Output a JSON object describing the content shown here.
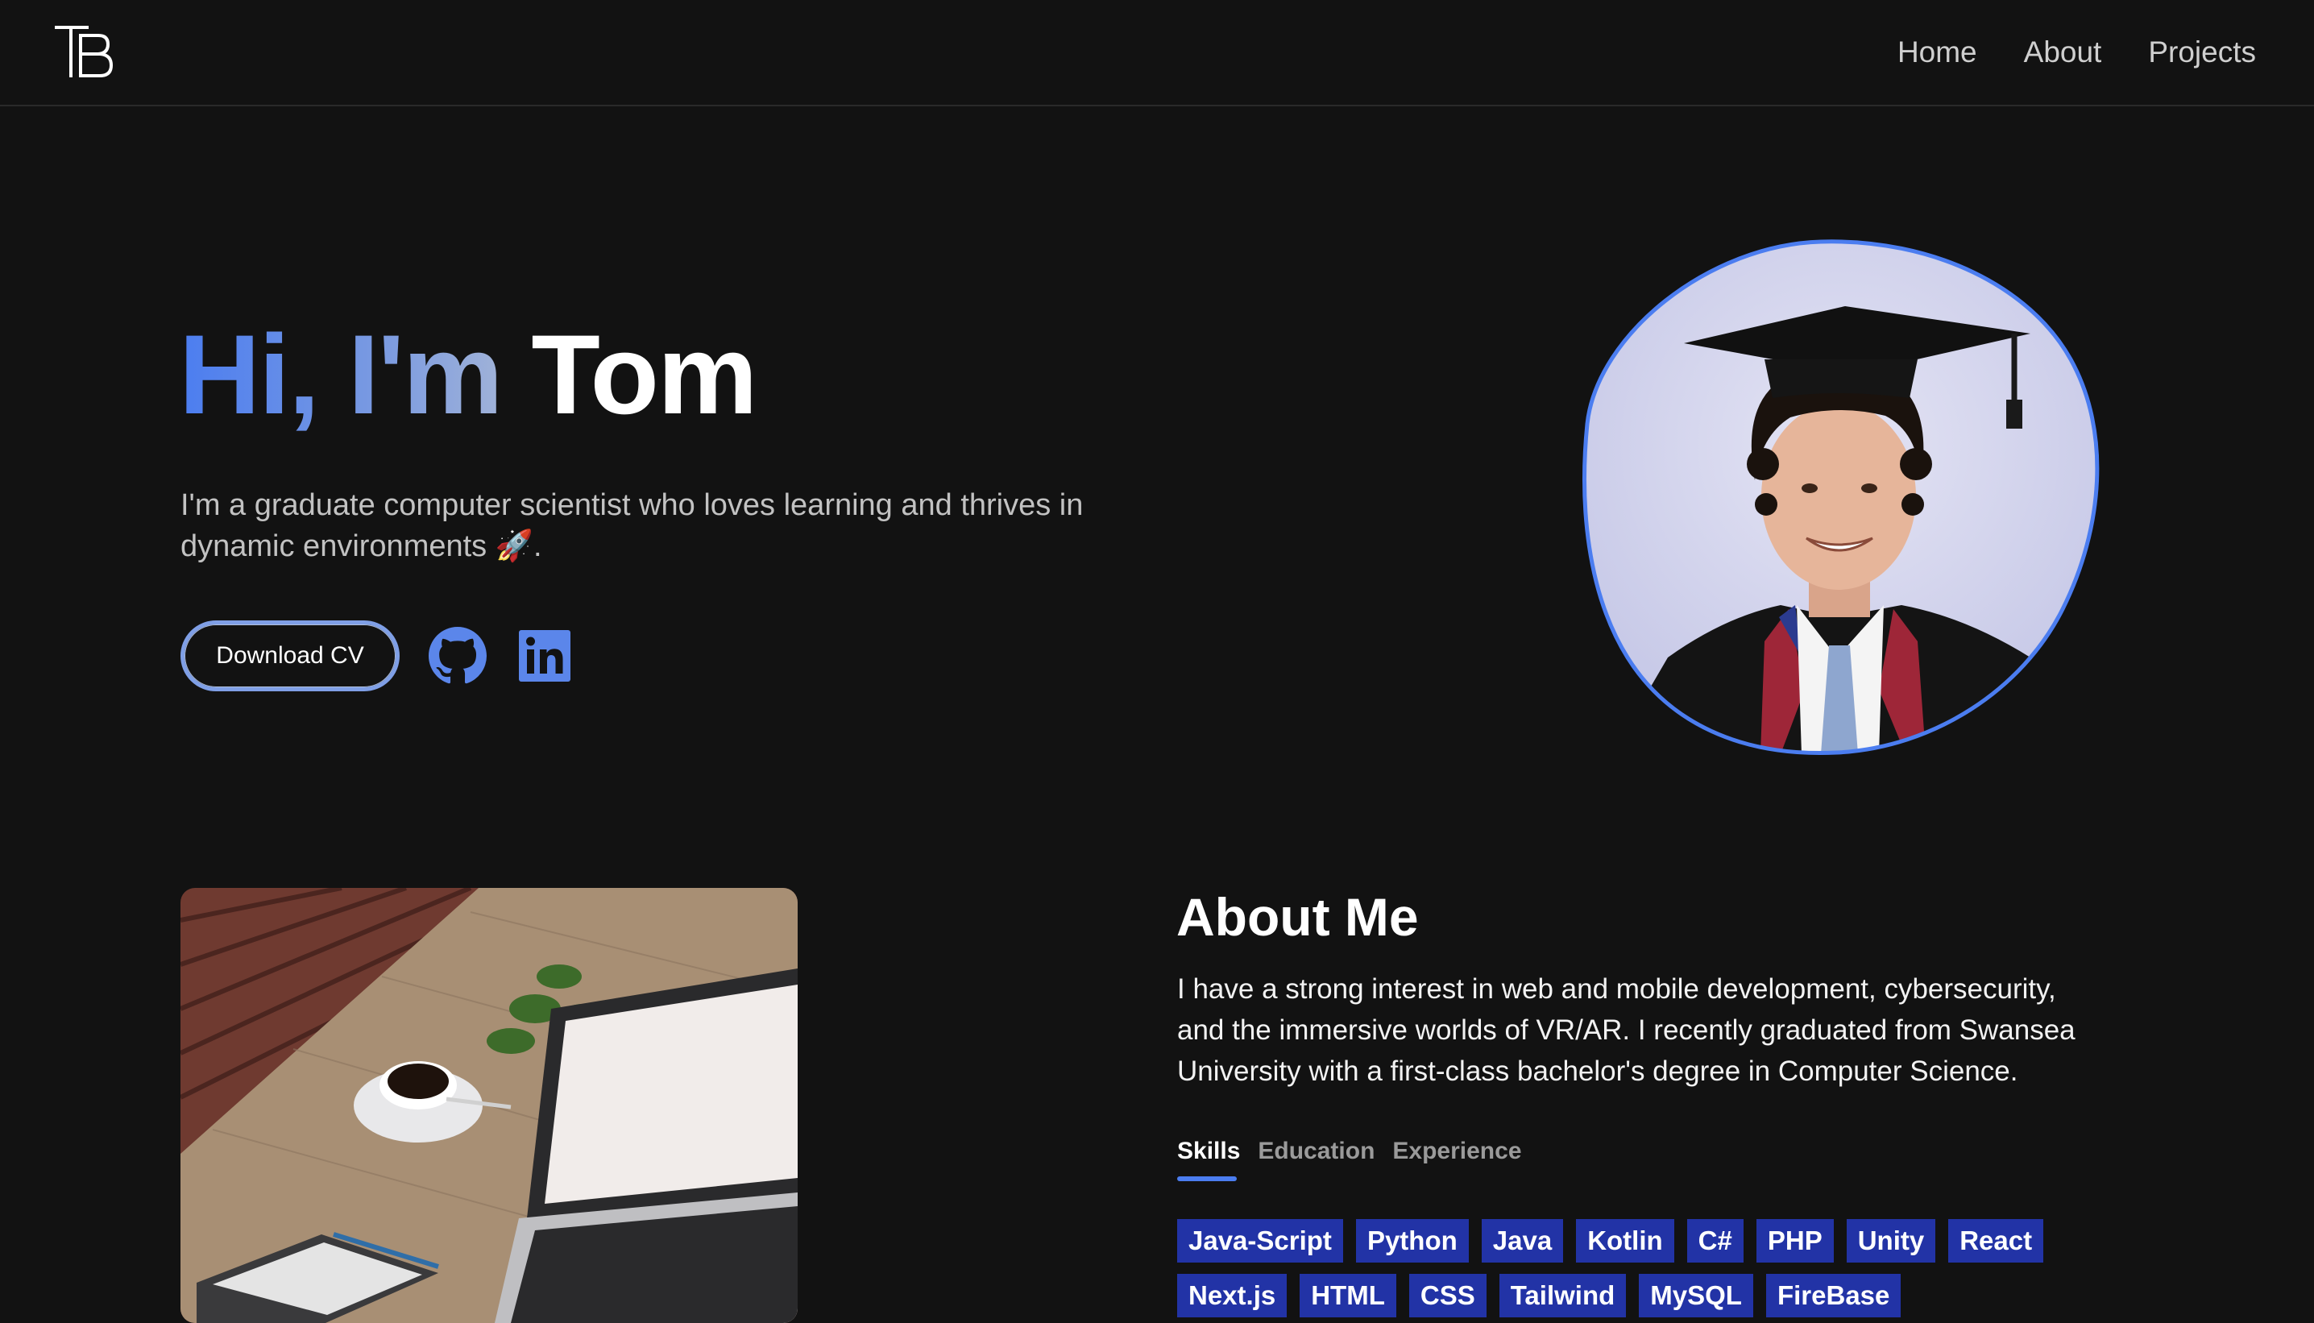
{
  "nav": {
    "logo_alt": "TB",
    "links": [
      {
        "label": "Home"
      },
      {
        "label": "About"
      },
      {
        "label": "Projects"
      }
    ]
  },
  "hero": {
    "greeting": "Hi, I'm ",
    "name": "Tom",
    "subtitle": "I'm a graduate computer scientist who loves learning and thrives in dynamic environments 🚀.",
    "cv_button": "Download CV",
    "icons": [
      "github-icon",
      "linkedin-icon"
    ]
  },
  "about": {
    "title": "About Me",
    "text": "I have a strong interest in web and mobile development, cybersecurity, and the immersive worlds of VR/AR. I recently graduated from Swansea University with a first-class bachelor's degree in Computer Science.",
    "tabs": [
      {
        "label": "Skills",
        "active": true
      },
      {
        "label": "Education",
        "active": false
      },
      {
        "label": "Experience",
        "active": false
      }
    ],
    "skills": [
      "Java-Script",
      "Python",
      "Java",
      "Kotlin",
      "C#",
      "PHP",
      "Unity",
      "React",
      "Next.js",
      "HTML",
      "CSS",
      "Tailwind",
      "MySQL",
      "FireBase"
    ]
  },
  "colors": {
    "background": "#121212",
    "accent": "#4b7df0",
    "skill_badge": "#2233a6"
  }
}
